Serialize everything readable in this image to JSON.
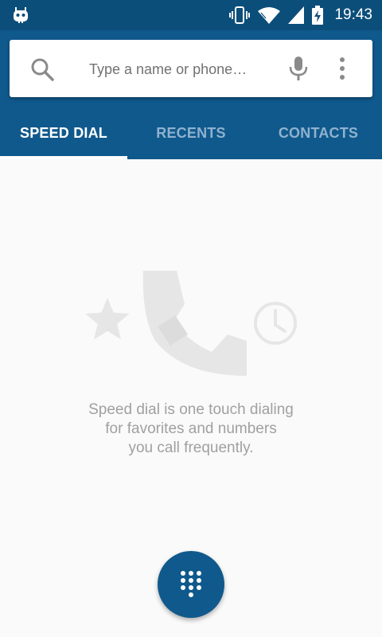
{
  "status_bar": {
    "time": "19:43",
    "icons": [
      "cyanogen-bug-icon",
      "vibrate-icon",
      "wifi-icon",
      "signal-icon",
      "battery-charging-icon"
    ]
  },
  "search": {
    "placeholder": "Type a name or phone…",
    "value": "",
    "icons": [
      "search-icon",
      "mic-icon",
      "more-vert-icon"
    ]
  },
  "tabs": [
    {
      "label": "SPEED DIAL",
      "selected": true
    },
    {
      "label": "RECENTS",
      "selected": false
    },
    {
      "label": "CONTACTS",
      "selected": false
    }
  ],
  "empty_state": {
    "illustration_icons": [
      "star-icon",
      "phone-handset-icon",
      "clock-icon"
    ],
    "lines": [
      "Speed dial is one touch dialing",
      "for favorites and numbers",
      "you call frequently."
    ]
  },
  "fab": {
    "icon": "dialpad-icon"
  },
  "colors": {
    "status_bar": "#0c4e7a",
    "toolbar": "#10598c",
    "tab_inactive": "#8fb2cf",
    "background": "#fafafa",
    "empty_text": "#a0a0a0"
  }
}
